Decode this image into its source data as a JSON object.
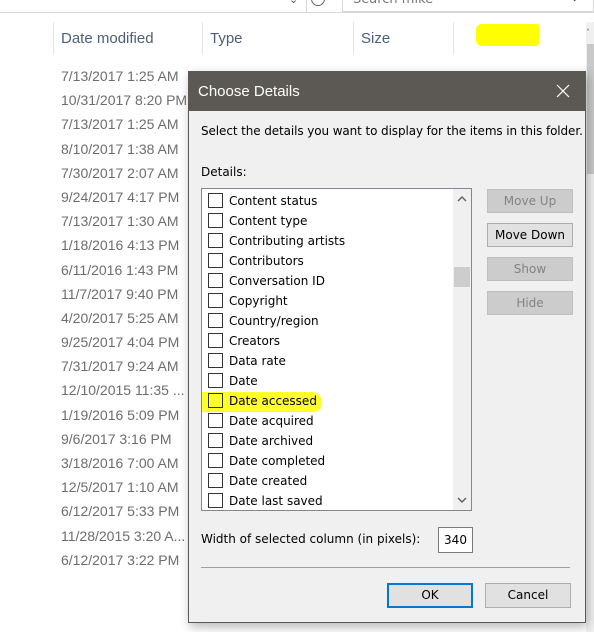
{
  "explorer": {
    "search_placeholder": "Search mike",
    "columns": [
      "Date modified",
      "Type",
      "Size"
    ],
    "dates": [
      "7/13/2017 1:25 AM",
      "10/31/2017 8:20 PM",
      "7/13/2017 1:25 AM",
      "8/10/2017 1:38 AM",
      "7/30/2017 2:07 AM",
      "9/24/2017 4:17 PM",
      "7/13/2017 1:30 AM",
      "1/18/2016 4:13 PM",
      "6/11/2016 1:43 PM",
      "11/7/2017 9:40 PM",
      "4/20/2017 5:25 AM",
      "9/25/2017 4:04 PM",
      "7/31/2017 9:24 AM",
      "12/10/2015 11:35 ...",
      "1/19/2016 5:09 PM",
      "9/6/2017 3:16 PM",
      "3/18/2016 7:00 AM",
      "12/5/2017 1:10 AM",
      "6/12/2017 5:33 PM",
      "11/28/2015 3:20 A...",
      "6/12/2017 3:22 PM"
    ]
  },
  "dialog": {
    "title": "Choose Details",
    "close_icon": "close-icon",
    "intro": "Select the details you want to display for the items in this folder.",
    "details_label": "Details:",
    "items": [
      {
        "label": "Content status",
        "checked": false
      },
      {
        "label": "Content type",
        "checked": false
      },
      {
        "label": "Contributing artists",
        "checked": false
      },
      {
        "label": "Contributors",
        "checked": false
      },
      {
        "label": "Conversation ID",
        "checked": false
      },
      {
        "label": "Copyright",
        "checked": false
      },
      {
        "label": "Country/region",
        "checked": false
      },
      {
        "label": "Creators",
        "checked": false
      },
      {
        "label": "Data rate",
        "checked": false
      },
      {
        "label": "Date",
        "checked": false
      },
      {
        "label": "Date accessed",
        "checked": false,
        "highlighted": true
      },
      {
        "label": "Date acquired",
        "checked": false
      },
      {
        "label": "Date archived",
        "checked": false
      },
      {
        "label": "Date completed",
        "checked": false
      },
      {
        "label": "Date created",
        "checked": false
      },
      {
        "label": "Date last saved",
        "checked": false
      }
    ],
    "buttons": {
      "move_up": "Move Up",
      "move_down": "Move Down",
      "show": "Show",
      "hide": "Hide",
      "ok": "OK",
      "cancel": "Cancel"
    },
    "width_label": "Width of selected column (in pixels):",
    "width_value": "340"
  },
  "colors": {
    "titlebar": "#5c5955",
    "highlight": "#ffff00",
    "default_button_border": "#0078d7",
    "column_header_text": "#4c607a"
  }
}
